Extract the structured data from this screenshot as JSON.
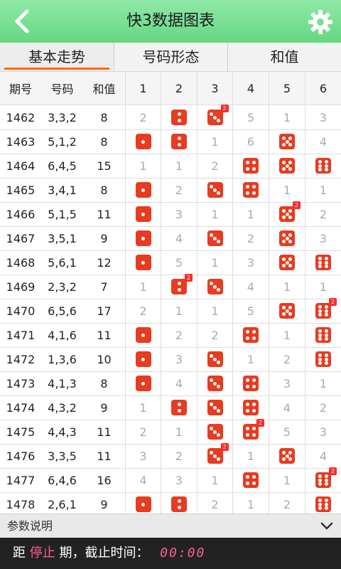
{
  "header": {
    "title": "快3数据图表"
  },
  "tabs": [
    {
      "label": "基本走势",
      "active": true
    },
    {
      "label": "号码形态",
      "active": false
    },
    {
      "label": "和值",
      "active": false
    }
  ],
  "columns": [
    "期号",
    "号码",
    "和值",
    "1",
    "2",
    "3",
    "4",
    "5",
    "6"
  ],
  "rows": [
    {
      "issue": "1462",
      "numbers": "3,3,2",
      "sum": "8",
      "cells": [
        {
          "miss": "2"
        },
        {
          "die": 2
        },
        {
          "die": 3,
          "count": "2"
        },
        {
          "miss": "5"
        },
        {
          "miss": "1"
        },
        {
          "miss": "3"
        }
      ]
    },
    {
      "issue": "1463",
      "numbers": "5,1,2",
      "sum": "8",
      "cells": [
        {
          "die": 1
        },
        {
          "die": 2
        },
        {
          "miss": "1"
        },
        {
          "miss": "6"
        },
        {
          "die": 5
        },
        {
          "miss": "4"
        }
      ]
    },
    {
      "issue": "1464",
      "numbers": "6,4,5",
      "sum": "15",
      "cells": [
        {
          "miss": "1"
        },
        {
          "miss": "1"
        },
        {
          "miss": "2"
        },
        {
          "die": 4
        },
        {
          "die": 5
        },
        {
          "die": 6
        }
      ]
    },
    {
      "issue": "1465",
      "numbers": "3,4,1",
      "sum": "8",
      "cells": [
        {
          "die": 1
        },
        {
          "miss": "2"
        },
        {
          "die": 3
        },
        {
          "die": 4
        },
        {
          "miss": "1"
        },
        {
          "miss": "1"
        }
      ]
    },
    {
      "issue": "1466",
      "numbers": "5,1,5",
      "sum": "11",
      "cells": [
        {
          "die": 1
        },
        {
          "miss": "3"
        },
        {
          "miss": "1"
        },
        {
          "miss": "1"
        },
        {
          "die": 5,
          "count": "2"
        },
        {
          "miss": "2"
        }
      ]
    },
    {
      "issue": "1467",
      "numbers": "3,5,1",
      "sum": "9",
      "cells": [
        {
          "die": 1
        },
        {
          "miss": "4"
        },
        {
          "die": 3
        },
        {
          "miss": "2"
        },
        {
          "die": 5
        },
        {
          "miss": "3"
        }
      ]
    },
    {
      "issue": "1468",
      "numbers": "5,6,1",
      "sum": "12",
      "cells": [
        {
          "die": 1
        },
        {
          "miss": "5"
        },
        {
          "miss": "1"
        },
        {
          "miss": "3"
        },
        {
          "die": 5
        },
        {
          "die": 6
        }
      ]
    },
    {
      "issue": "1469",
      "numbers": "2,3,2",
      "sum": "7",
      "cells": [
        {
          "miss": "1"
        },
        {
          "die": 2,
          "count": "2"
        },
        {
          "die": 3
        },
        {
          "miss": "4"
        },
        {
          "miss": "1"
        },
        {
          "miss": "1"
        }
      ]
    },
    {
      "issue": "1470",
      "numbers": "6,5,6",
      "sum": "17",
      "cells": [
        {
          "miss": "2"
        },
        {
          "miss": "1"
        },
        {
          "miss": "1"
        },
        {
          "miss": "5"
        },
        {
          "die": 5
        },
        {
          "die": 6,
          "count": "2"
        }
      ]
    },
    {
      "issue": "1471",
      "numbers": "4,1,6",
      "sum": "11",
      "cells": [
        {
          "die": 1
        },
        {
          "miss": "2"
        },
        {
          "miss": "2"
        },
        {
          "die": 4
        },
        {
          "miss": "1"
        },
        {
          "die": 6
        }
      ]
    },
    {
      "issue": "1472",
      "numbers": "1,3,6",
      "sum": "10",
      "cells": [
        {
          "die": 1
        },
        {
          "miss": "3"
        },
        {
          "die": 3
        },
        {
          "miss": "1"
        },
        {
          "miss": "2"
        },
        {
          "die": 6
        }
      ]
    },
    {
      "issue": "1473",
      "numbers": "4,1,3",
      "sum": "8",
      "cells": [
        {
          "die": 1
        },
        {
          "miss": "4"
        },
        {
          "die": 3
        },
        {
          "die": 4
        },
        {
          "miss": "3"
        },
        {
          "miss": "1"
        }
      ]
    },
    {
      "issue": "1474",
      "numbers": "4,3,2",
      "sum": "9",
      "cells": [
        {
          "miss": "1"
        },
        {
          "die": 2
        },
        {
          "die": 3
        },
        {
          "die": 4
        },
        {
          "miss": "4"
        },
        {
          "miss": "2"
        }
      ]
    },
    {
      "issue": "1475",
      "numbers": "4,4,3",
      "sum": "11",
      "cells": [
        {
          "miss": "2"
        },
        {
          "miss": "1"
        },
        {
          "die": 3
        },
        {
          "die": 4,
          "count": "2"
        },
        {
          "miss": "5"
        },
        {
          "miss": "3"
        }
      ]
    },
    {
      "issue": "1476",
      "numbers": "3,3,5",
      "sum": "11",
      "cells": [
        {
          "miss": "3"
        },
        {
          "miss": "2"
        },
        {
          "die": 3,
          "count": "2"
        },
        {
          "miss": "1"
        },
        {
          "die": 5
        },
        {
          "miss": "4"
        }
      ]
    },
    {
      "issue": "1477",
      "numbers": "6,4,6",
      "sum": "16",
      "cells": [
        {
          "miss": "4"
        },
        {
          "miss": "3"
        },
        {
          "miss": "1"
        },
        {
          "die": 4
        },
        {
          "miss": "1"
        },
        {
          "die": 6,
          "count": "2"
        }
      ]
    },
    {
      "issue": "1478",
      "numbers": "2,6,1",
      "sum": "9",
      "cells": [
        {
          "die": 1
        },
        {
          "die": 2
        },
        {
          "miss": "2"
        },
        {
          "miss": "1"
        },
        {
          "miss": "2"
        },
        {
          "die": 6
        }
      ]
    }
  ],
  "footer": {
    "param_label": "参数说明",
    "prefix": "距",
    "stop": "停止",
    "suffix": "期，截止时间：",
    "time": "00:00"
  },
  "colors": {
    "accent": "#ff6a00",
    "die": "#e83b1f",
    "header": "#66d683"
  },
  "icons": {
    "back": "chevron-left-icon",
    "settings": "gear-icon",
    "expand": "chevron-down-icon"
  }
}
